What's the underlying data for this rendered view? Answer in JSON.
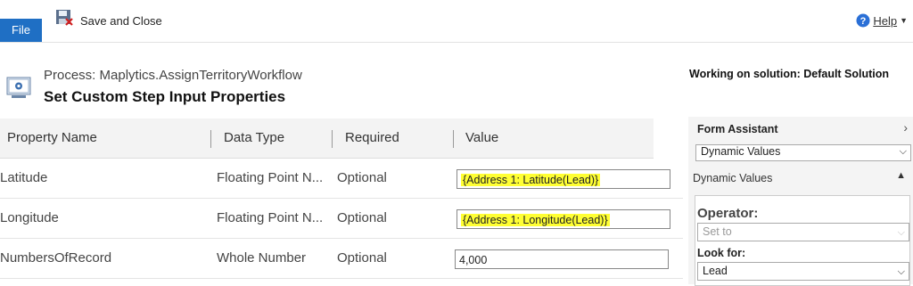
{
  "toolbar": {
    "file_label": "File",
    "save_close_label": "Save and Close",
    "help_label": "Help"
  },
  "header": {
    "process_label": "Process: Maplytics.AssignTerritoryWorkflow",
    "title": "Set Custom Step Input Properties",
    "solution": "Working on solution: Default Solution"
  },
  "grid": {
    "columns": [
      "Property Name",
      "Data Type",
      "Required",
      "Value"
    ],
    "rows": [
      {
        "name": "Latitude",
        "type": "Floating Point N...",
        "required": "Optional",
        "value": "{Address 1: Latitude(Lead)}"
      },
      {
        "name": "Longitude",
        "type": "Floating Point N...",
        "required": "Optional",
        "value": "{Address 1: Longitude(Lead)}"
      },
      {
        "name": "NumbersOfRecord",
        "type": "Whole Number",
        "required": "Optional",
        "value": "4,000"
      }
    ]
  },
  "form_assistant": {
    "title": "Form Assistant",
    "selected": "Dynamic Values",
    "section_title": "Dynamic Values",
    "operator_label": "Operator:",
    "operator_value": "Set to",
    "look_for_label": "Look for:",
    "look_for_value": "Lead"
  },
  "colors": {
    "file_bg": "#1f6fc4",
    "highlight": "#ffff33"
  }
}
